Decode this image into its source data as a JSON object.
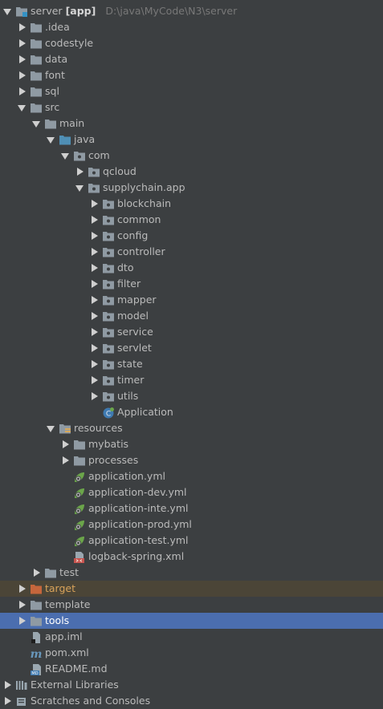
{
  "project_tree": {
    "root": {
      "name": "server",
      "module_tag": "[app]",
      "path": "D:\\java\\MyCode\\N3\\server"
    },
    "idea": ".idea",
    "codestyle": "codestyle",
    "data": "data",
    "font": "font",
    "sql": "sql",
    "src": "src",
    "main": "main",
    "java": "java",
    "com": "com",
    "qcloud": "qcloud",
    "supplychain_app": "supplychain.app",
    "blockchain": "blockchain",
    "common": "common",
    "config": "config",
    "controller": "controller",
    "dto": "dto",
    "filter": "filter",
    "mapper": "mapper",
    "model": "model",
    "service": "service",
    "servlet": "servlet",
    "state": "state",
    "timer": "timer",
    "utils": "utils",
    "application_class": "Application",
    "resources": "resources",
    "mybatis": "mybatis",
    "processes": "processes",
    "application_yml": "application.yml",
    "application_dev_yml": "application-dev.yml",
    "application_inte_yml": "application-inte.yml",
    "application_prod_yml": "application-prod.yml",
    "application_test_yml": "application-test.yml",
    "logback_xml": "logback-spring.xml",
    "test": "test",
    "target": "target",
    "template": "template",
    "tools": "tools",
    "app_iml": "app.iml",
    "pom_xml": "pom.xml",
    "readme": "README.md",
    "external_libraries": "External Libraries",
    "scratches": "Scratches and Consoles"
  },
  "colors": {
    "background": "#3c3f41",
    "selected_row": "#4b6eaf",
    "target_row": "#4b4537",
    "folder": "#8f9aa3",
    "source_folder": "#4f8fb5",
    "excluded_folder": "#c5663c",
    "spring_leaf": "#6ba54a"
  }
}
